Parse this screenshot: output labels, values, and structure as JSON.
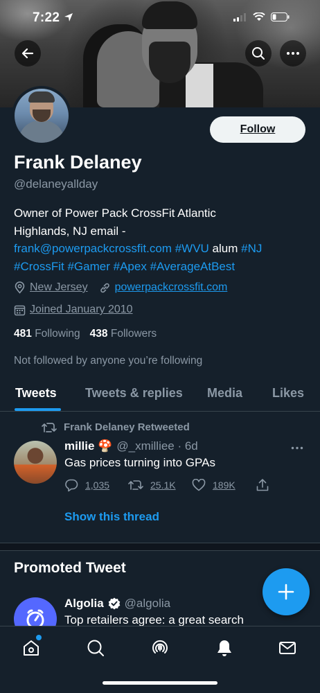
{
  "status_bar": {
    "time": "7:22"
  },
  "profile": {
    "name": "Frank Delaney",
    "handle": "@delaneyallday",
    "follow_label": "Follow",
    "bio": {
      "line1": "Owner of Power Pack CrossFit Atlantic",
      "line2": "Highlands, NJ email -",
      "email": "frank@powerpackcrossfit.com",
      "tag_wvu": "#WVU",
      "alum": " alum ",
      "tag_nj": "#NJ",
      "tag_crossfit": "#CrossFit",
      "tag_gamer": "#Gamer",
      "tag_apex": "#Apex",
      "tag_average": "#AverageAtBest"
    },
    "location": "New Jersey",
    "website": "powerpackcrossfit.com",
    "joined": "Joined January 2010",
    "following_count": "481",
    "following_label": "Following",
    "followers_count": "438",
    "followers_label": "Followers",
    "not_followed": "Not followed by anyone you’re following"
  },
  "tabs": [
    "Tweets",
    "Tweets & replies",
    "Media",
    "Likes"
  ],
  "retweet": {
    "label": "Frank Delaney Retweeted",
    "name": "millie 🍄",
    "handle": "@_xmilliee · 6d",
    "text": "Gas prices turning into GPAs",
    "replies": "1,035",
    "retweets": "25.1K",
    "likes": "189K",
    "show_thread": "Show this thread"
  },
  "promoted": {
    "title": "Promoted Tweet",
    "name": "Algolia",
    "handle": "@algolia",
    "text": "Top retailers agree: a great search"
  },
  "colors": {
    "accent": "#1d9bf0",
    "background": "#15202b",
    "muted": "#8b98a5"
  }
}
